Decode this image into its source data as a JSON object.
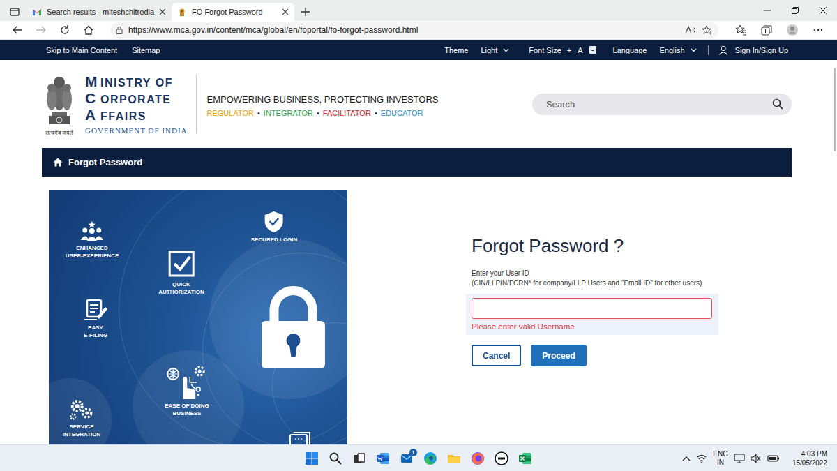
{
  "browser": {
    "tabs": [
      {
        "label": "Search results - miteshchitrodia",
        "selected": false
      },
      {
        "label": "FO Forgot Password",
        "selected": true
      }
    ],
    "address": "https://www.mca.gov.in/content/mca/global/en/foportal/fo-forgot-password.html"
  },
  "top_nav": {
    "left": [
      "Skip to Main Content",
      "Sitemap"
    ],
    "theme_label": "Theme",
    "theme_value": "Light",
    "font_size_label": "Font Size",
    "font_controls": [
      "+",
      "A",
      "-"
    ],
    "language_label": "Language",
    "language_value": "English",
    "sign_in": "Sign In/Sign Up"
  },
  "header": {
    "logo_lines": [
      {
        "initial": "M",
        "rest": "INISTRY OF"
      },
      {
        "initial": "C",
        "rest": "ORPORATE"
      },
      {
        "initial": "A",
        "rest": "FFAIRS"
      }
    ],
    "government": "GOVERNMENT OF INDIA",
    "motto": "सत्यमेव जयते",
    "tagline": "EMPOWERING BUSINESS, PROTECTING INVESTORS",
    "roles": [
      {
        "label": "REGULATOR",
        "color": "#f0a000"
      },
      {
        "label": "INTEGRATOR",
        "color": "#2fa84f"
      },
      {
        "label": "FACILITATOR",
        "color": "#d6262b"
      },
      {
        "label": "EDUCATOR",
        "color": "#2b8fd6"
      }
    ],
    "separator": "•",
    "search": {
      "placeholder": "Search"
    }
  },
  "breadcrumb": {
    "label": "Forgot Password"
  },
  "banner": {
    "features": [
      {
        "lines": [
          "ENHANCED",
          "USER-EXPERIENCE"
        ]
      },
      {
        "lines": [
          "SECURED LOGIN"
        ]
      },
      {
        "lines": [
          "QUICK",
          "AUTHORIZATION"
        ]
      },
      {
        "lines": [
          "EASY",
          "E-FILING"
        ]
      },
      {
        "lines": [
          "EASE OF DOING",
          "BUSINESS"
        ]
      },
      {
        "lines": [
          "SERVICE",
          "INTEGRATION"
        ]
      }
    ]
  },
  "form": {
    "title": "Forgot Password ?",
    "hint": [
      "Enter your User ID",
      "(CIN/LLPIN/FCRN* for company/LLP Users and \"Email ID\" for other users)"
    ],
    "user_id": {
      "value": "",
      "invalid": true
    },
    "error": "Please enter valid Username",
    "buttons": [
      {
        "label": "Cancel",
        "kind": "outline"
      },
      {
        "label": "Proceed",
        "kind": "primary"
      }
    ]
  },
  "taskbar": {
    "mail_badge": "1",
    "language": [
      "ENG",
      "IN"
    ],
    "time": "4:03 PM",
    "date": "15/05/2022"
  }
}
